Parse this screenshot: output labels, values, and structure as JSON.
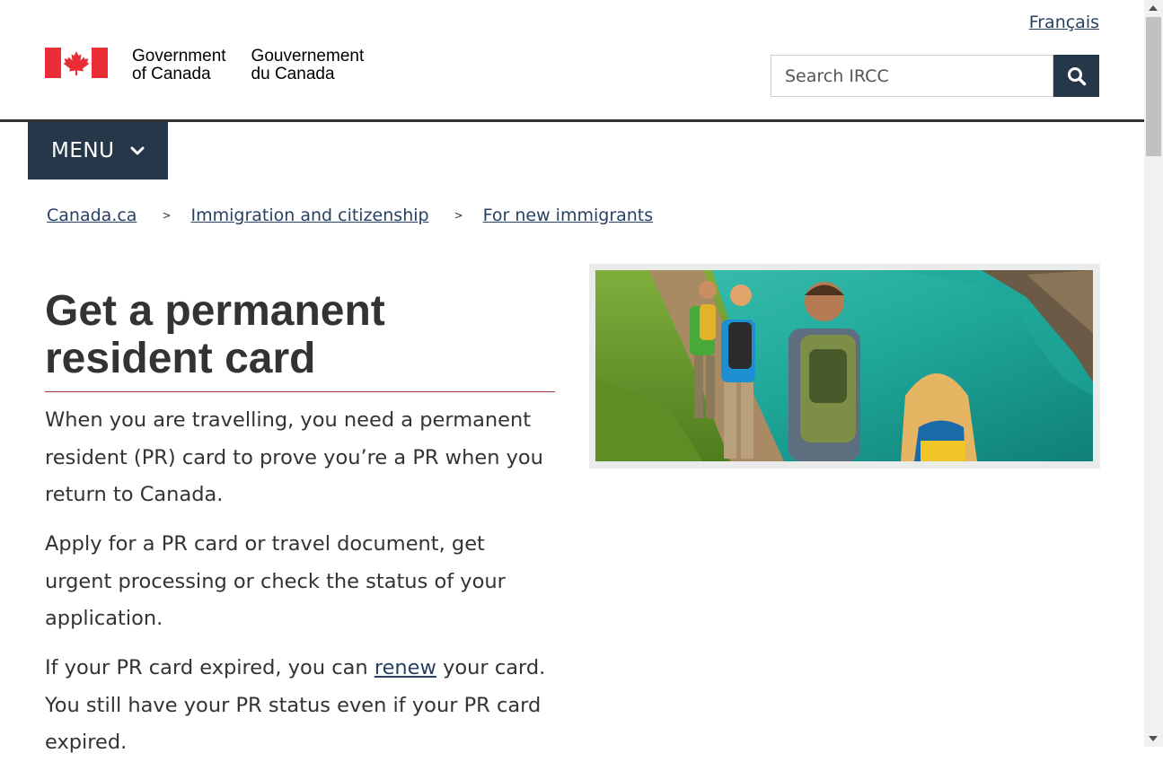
{
  "header": {
    "language_link": "Français",
    "signature": {
      "en_line1": "Government",
      "en_line2": "of Canada",
      "fr_line1": "Gouvernement",
      "fr_line2": "du Canada"
    },
    "search": {
      "placeholder": "Search IRCC",
      "value": "",
      "button_icon": "search-icon"
    },
    "flag_icon": "canada-flag-icon"
  },
  "menu": {
    "label": "MENU",
    "icon": "chevron-down-icon"
  },
  "breadcrumb": {
    "items": [
      {
        "label": "Canada.ca"
      },
      {
        "label": "Immigration and citizenship"
      },
      {
        "label": "For new immigrants"
      }
    ],
    "separator": ">"
  },
  "main": {
    "title": "Get a permanent resident card",
    "paragraphs": {
      "p1": "When you are travelling, you need a permanent resident (PR) card to prove you’re a PR when you return to Canada.",
      "p2": "Apply for a PR card or travel document, get urgent processing or check the status of your application.",
      "p3_before": "If your PR card expired, you can ",
      "p3_link": "renew",
      "p3_after": " your card. You still have your PR status even if your PR card expired."
    }
  },
  "colors": {
    "navy": "#26374a",
    "link": "#284162",
    "text": "#333333",
    "rule_red": "#af3c43",
    "flag_red": "#eb2d37"
  }
}
